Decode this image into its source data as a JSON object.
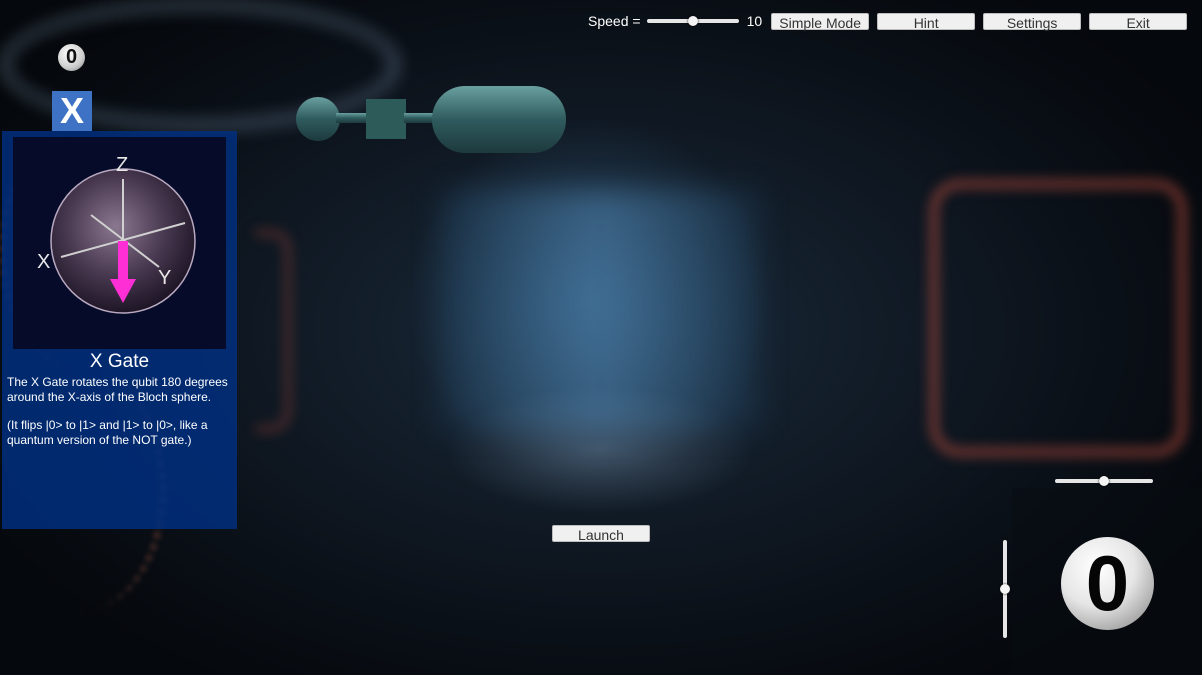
{
  "topbar": {
    "speed_label": "Speed =",
    "speed_value": "10",
    "speed_level": 0.5,
    "simple_mode_label": "Simple Mode",
    "hint_label": "Hint",
    "settings_label": "Settings",
    "exit_label": "Exit"
  },
  "score": "0",
  "gate_tile": {
    "symbol": "X",
    "color": "#3e72c4"
  },
  "info_panel": {
    "title": "X Gate",
    "description": "The X Gate rotates the qubit 180 degrees around the X-axis of the Bloch sphere.",
    "note": "(It flips |0> to |1> and |1> to |0>, like a quantum version of the NOT gate.)",
    "bloch": {
      "axis_z": "Z",
      "axis_x": "X",
      "axis_y": "Y",
      "vector_color": "#ff2fd6"
    }
  },
  "launch_label": "Launch",
  "right_controls": {
    "horizontal_level": 0.5,
    "vertical_level": 0.5
  },
  "qubit_state": "0"
}
